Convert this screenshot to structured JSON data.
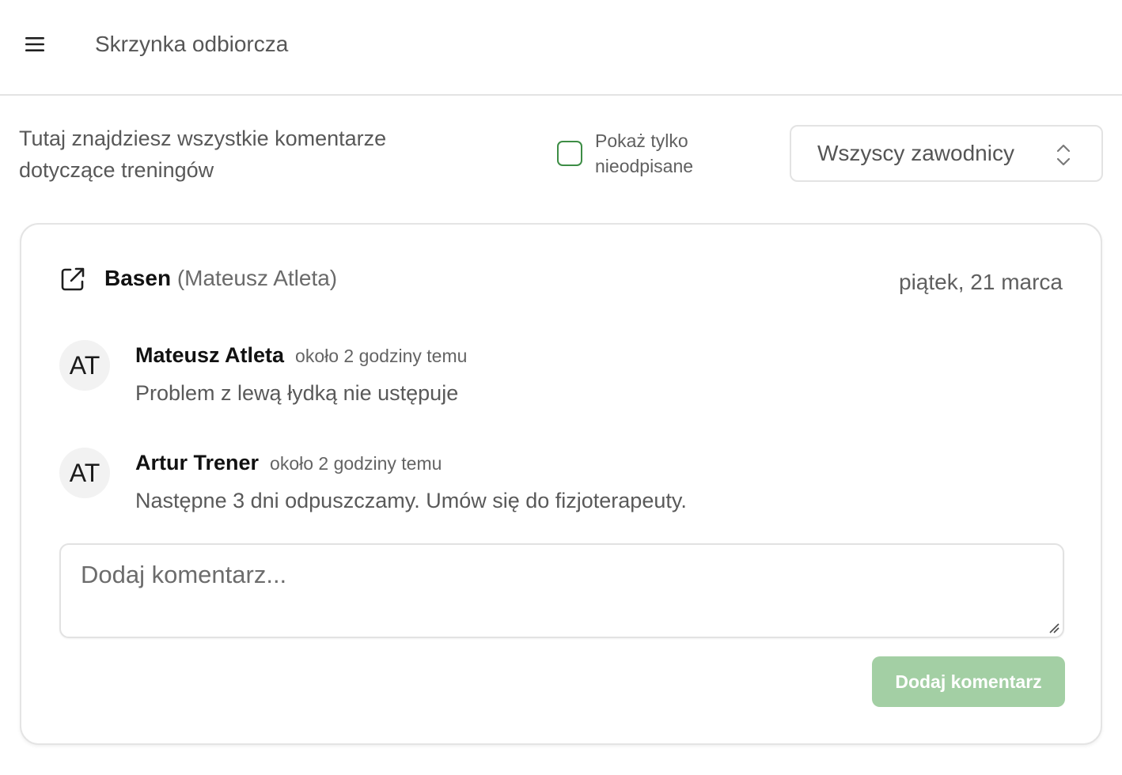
{
  "header": {
    "title": "Skrzynka odbiorcza",
    "menu_icon": "hamburger-menu-icon"
  },
  "toolbar": {
    "intro_text": "Tutaj znajdziesz wszystkie komentarze dotyczące treningów",
    "unanswered_only_label": "Pokaż tylko nieodpisane",
    "unanswered_only_checked": false,
    "athlete_select": {
      "value": "Wszyscy zawodnicy",
      "icon": "chevron-up-down-icon"
    }
  },
  "card": {
    "workout_link_icon": "external-link-icon",
    "workout_name": "Basen",
    "workout_athlete": "(Mateusz Atleta)",
    "date": "piątek, 21 marca",
    "comments": [
      {
        "initials": "AT",
        "author": "Mateusz Atleta",
        "time": "około 2 godziny temu",
        "text": "Problem z lewą łydką nie ustępuje"
      },
      {
        "initials": "AT",
        "author": "Artur Trener",
        "time": "około 2 godziny temu",
        "text": "Następne 3 dni odpuszczamy. Umów się do fizjoterapeuty."
      }
    ],
    "input": {
      "value": "",
      "placeholder": "Dodaj komentarz..."
    },
    "submit_label": "Dodaj komentarz"
  },
  "colors": {
    "accent": "#3d8d45",
    "button_disabled": "#a3cfa4",
    "border": "#e3e3e3"
  }
}
